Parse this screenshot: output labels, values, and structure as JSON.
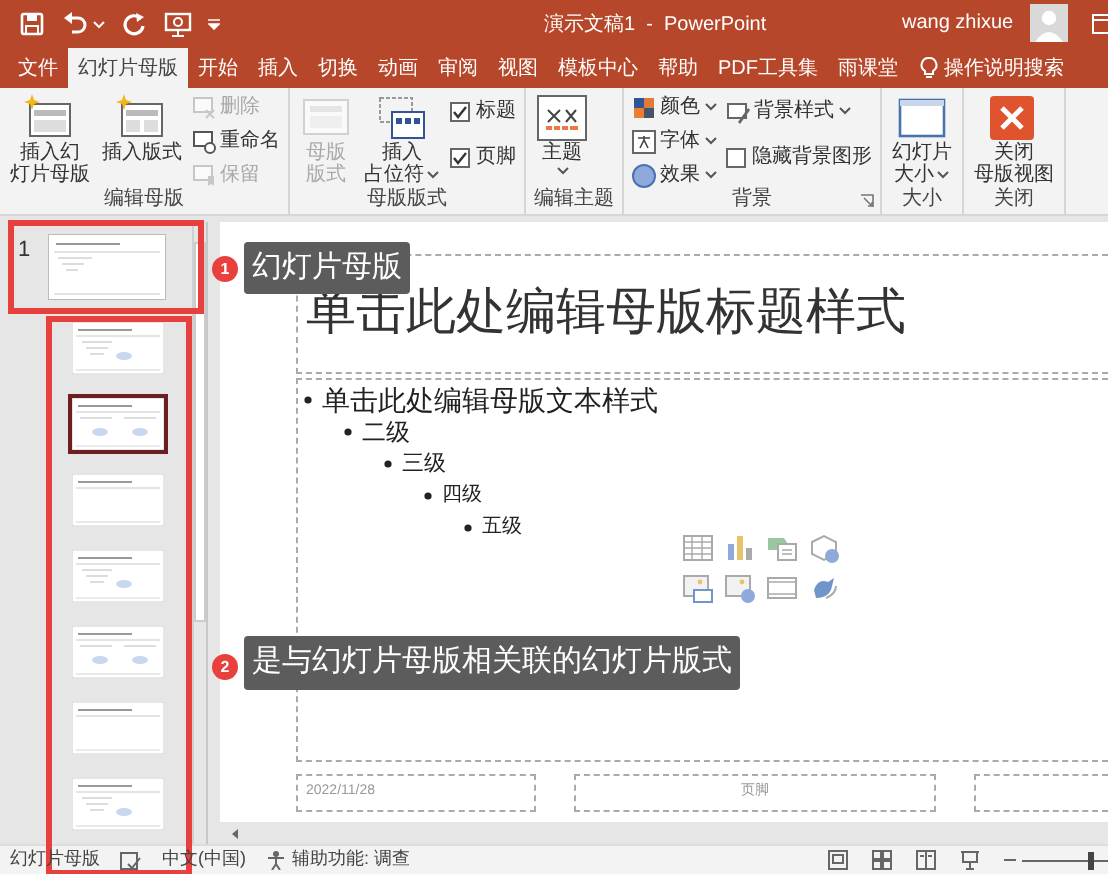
{
  "window": {
    "title": "演示文稿1  -  PowerPoint",
    "user": "wang zhixue"
  },
  "tabs": [
    {
      "label": "文件",
      "selected": false
    },
    {
      "label": "幻灯片母版",
      "selected": true
    },
    {
      "label": "开始",
      "selected": false
    },
    {
      "label": "插入",
      "selected": false
    },
    {
      "label": "切换",
      "selected": false
    },
    {
      "label": "动画",
      "selected": false
    },
    {
      "label": "审阅",
      "selected": false
    },
    {
      "label": "视图",
      "selected": false
    },
    {
      "label": "模板中心",
      "selected": false
    },
    {
      "label": "帮助",
      "selected": false
    },
    {
      "label": "PDF工具集",
      "selected": false
    },
    {
      "label": "雨课堂",
      "selected": false
    }
  ],
  "tell_me": "操作说明搜索",
  "ribbon": {
    "groups": [
      {
        "title": "编辑母版",
        "items": [
          {
            "kind": "large",
            "lines": [
              "插入幻",
              "灯片母版"
            ],
            "disabled": false,
            "dropdown": false
          },
          {
            "kind": "large",
            "lines": [
              "插入版式"
            ],
            "disabled": false,
            "dropdown": false
          },
          {
            "kind": "stack",
            "items": [
              {
                "kind": "small",
                "label": "删除",
                "disabled": true,
                "dropdown": false
              },
              {
                "kind": "small",
                "label": "重命名",
                "disabled": false,
                "dropdown": false
              },
              {
                "kind": "small",
                "label": "保留",
                "disabled": true,
                "dropdown": false
              }
            ]
          }
        ]
      },
      {
        "title": "母版版式",
        "items": [
          {
            "kind": "large",
            "lines": [
              "母版",
              "版式"
            ],
            "disabled": true,
            "dropdown": false
          },
          {
            "kind": "large",
            "lines": [
              "插入",
              "占位符"
            ],
            "disabled": false,
            "dropdown": true
          },
          {
            "kind": "stack",
            "items": [
              {
                "kind": "check",
                "label": "标题",
                "checked": true
              },
              {
                "kind": "check",
                "label": "页脚",
                "checked": true
              }
            ]
          }
        ]
      },
      {
        "title": "编辑主题",
        "items": [
          {
            "kind": "large",
            "lines": [
              "主题"
            ],
            "disabled": false,
            "dropdown": true
          }
        ]
      },
      {
        "title": "背景",
        "launcher": true,
        "items": [
          {
            "kind": "stack",
            "items": [
              {
                "kind": "small",
                "label": "颜色",
                "disabled": false,
                "dropdown": true
              },
              {
                "kind": "small",
                "label": "字体",
                "disabled": false,
                "dropdown": true
              },
              {
                "kind": "small",
                "label": "效果",
                "disabled": false,
                "dropdown": true
              }
            ]
          },
          {
            "kind": "stack",
            "items": [
              {
                "kind": "small",
                "label": "背景样式",
                "disabled": false,
                "dropdown": true
              },
              {
                "kind": "check",
                "label": "隐藏背景图形",
                "checked": false
              }
            ]
          }
        ]
      },
      {
        "title": "大小",
        "items": [
          {
            "kind": "large",
            "lines": [
              "幻灯片",
              "大小"
            ],
            "disabled": false,
            "dropdown": true
          }
        ]
      },
      {
        "title": "关闭",
        "items": [
          {
            "kind": "large",
            "lines": [
              "关闭",
              "母版视图"
            ],
            "disabled": false,
            "dropdown": false
          }
        ]
      }
    ]
  },
  "thumbnails": {
    "master": {
      "number": "1"
    },
    "layouts": [
      {
        "selected": false
      },
      {
        "selected": true
      },
      {
        "selected": false
      },
      {
        "selected": false
      },
      {
        "selected": false
      },
      {
        "selected": false
      },
      {
        "selected": false
      }
    ]
  },
  "slide": {
    "title": "单击此处编辑母版标题样式",
    "body": [
      {
        "text": "单击此处编辑母版文本样式",
        "children": [
          {
            "text": "二级",
            "children": [
              {
                "text": "三级",
                "children": [
                  {
                    "text": "四级",
                    "children": [
                      {
                        "text": "五级"
                      }
                    ]
                  }
                ]
              }
            ]
          }
        ]
      }
    ],
    "date": "2022/11/28",
    "footer": "页脚"
  },
  "callouts": [
    {
      "number": "1",
      "text": "幻灯片母版"
    },
    {
      "number": "2",
      "text": "是与幻灯片母版相关联的幻灯片版式"
    }
  ],
  "status_bar": {
    "mode": "幻灯片母版",
    "language": "中文(中国)",
    "accessibility": "辅助功能: 调查",
    "zoom": {
      "level": 0.75
    }
  }
}
